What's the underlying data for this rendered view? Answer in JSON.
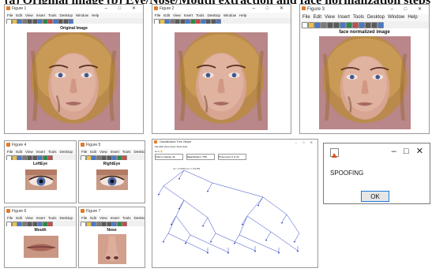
{
  "caption": "(a) Original image (b) Eye/Nose/Mouth extraction and face normalization steps",
  "menu": [
    "File",
    "Edit",
    "View",
    "Insert",
    "Tools",
    "Desktop",
    "Window",
    "Help"
  ],
  "window_controls": "–  □  ✕",
  "fig1": {
    "title": "Figure 1",
    "axes_title": "Original Image"
  },
  "fig2": {
    "title": "Figure 2"
  },
  "fig3": {
    "title": "Figure 3",
    "axes_title": "face normalized image"
  },
  "fig_left_eye": {
    "title": "Figure 4",
    "axes_title": "LeftEye"
  },
  "fig_right_eye": {
    "title": "Figure 5",
    "axes_title": "RightEye"
  },
  "fig_mouth": {
    "title": "Figure 6",
    "axes_title": "Mouth"
  },
  "fig_nose": {
    "title": "Figure 7",
    "axes_title": "Nose"
  },
  "tree_viewer": {
    "title": "Classification Tree Viewer",
    "menu": "File  Edit  View  Insert  Tools  Help",
    "controls": [
      "Click to display: ID",
      "Magnification: 75%",
      "Prune level: 0 of 23"
    ],
    "root_rule": "x4 < 0.0765   x4 >= 0.0765"
  },
  "dialog": {
    "message": "SPOOFING",
    "ok_label": "OK",
    "controls": "–   □   ✕"
  },
  "colors": {
    "accent": "#1a7bd8",
    "window_bg": "#f0f0f0",
    "tree_line": "#2a40c8"
  }
}
